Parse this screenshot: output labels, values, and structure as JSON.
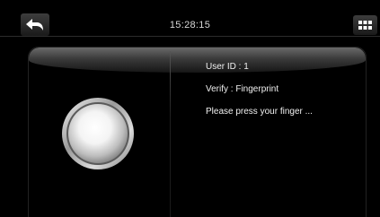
{
  "header": {
    "time": "15:28:15",
    "back_icon": "back-arrow-icon",
    "menu_icon": "grid-menu-icon"
  },
  "verify": {
    "user_id": "User ID : 1",
    "method": "Verify : Fingerprint",
    "prompt": "Please press your finger ..."
  },
  "colors": {
    "background": "#000000",
    "text": "#f0f0f0"
  }
}
